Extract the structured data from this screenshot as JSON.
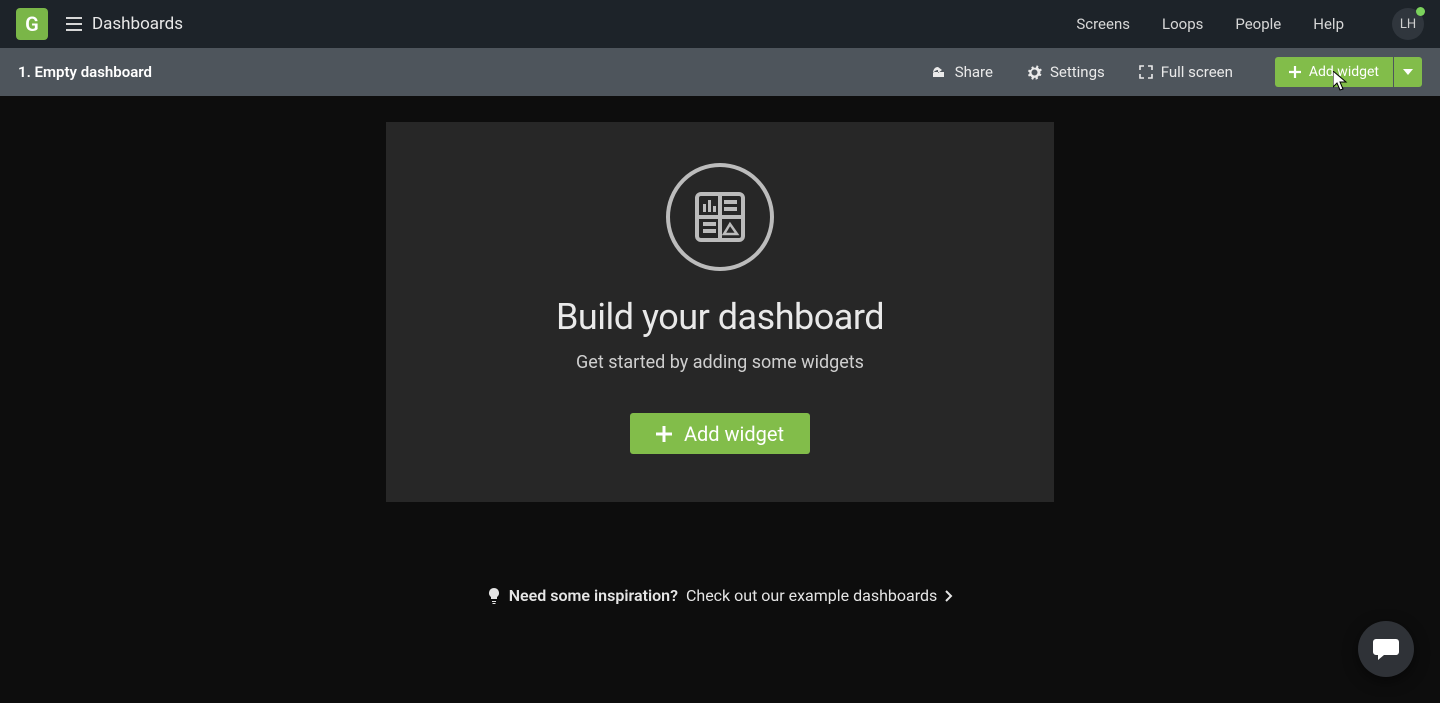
{
  "header": {
    "logo_letter": "G",
    "page_label": "Dashboards",
    "nav": [
      "Screens",
      "Loops",
      "People",
      "Help"
    ],
    "avatar_initials": "LH"
  },
  "subbar": {
    "title": "1. Empty dashboard",
    "share": "Share",
    "settings": "Settings",
    "fullscreen": "Full screen",
    "add_widget": "Add widget"
  },
  "card": {
    "title": "Build your dashboard",
    "subtitle": "Get started by adding some widgets",
    "button": "Add widget"
  },
  "inspiration": {
    "bold": "Need some inspiration?",
    "rest": "Check out our example dashboards"
  }
}
